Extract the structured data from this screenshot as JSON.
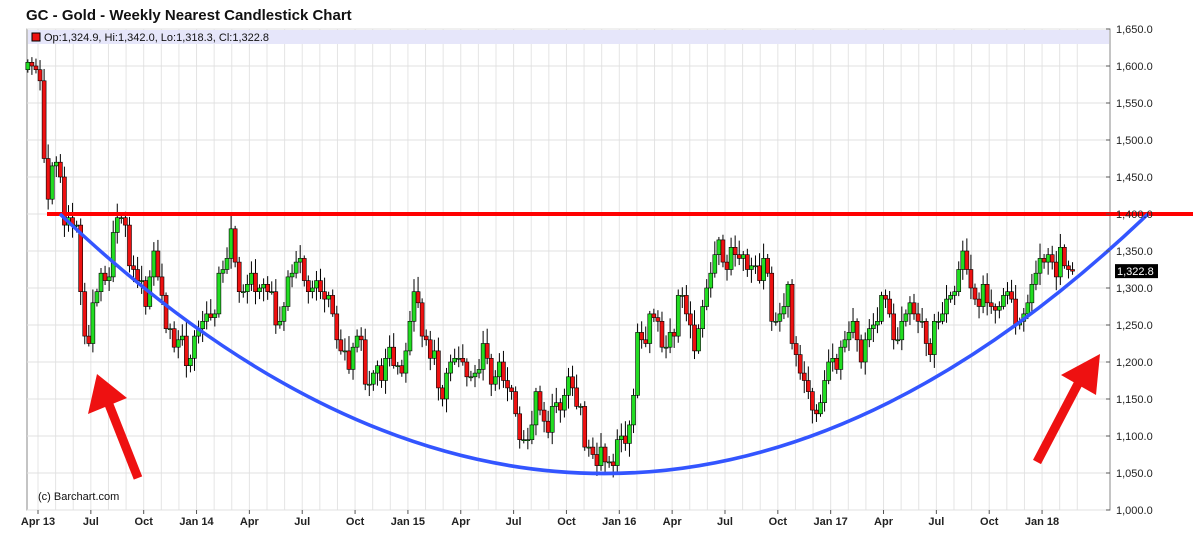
{
  "title": "GC - Gold - Weekly Nearest Candlestick Chart",
  "chart_data": {
    "type": "candlestick",
    "title": "GC - Gold - Weekly Nearest Candlestick Chart",
    "ohlc_label": "Op:1,324.9, Hi:1,342.0, Lo:1,318.3, Cl:1,322.8",
    "last_price_label": "1,322.8",
    "last_price": 1322.8,
    "ylim": [
      1000,
      1650
    ],
    "yticks": [
      "1,000.0",
      "1,050.0",
      "1,100.0",
      "1,150.0",
      "1,200.0",
      "1,250.0",
      "1,300.0",
      "1,350.0",
      "1,400.0",
      "1,450.0",
      "1,500.0",
      "1,550.0",
      "1,600.0",
      "1,650.0"
    ],
    "xticks": [
      "Apr 13",
      "Jul",
      "Oct",
      "Jan 14",
      "Apr",
      "Jul",
      "Oct",
      "Jan 15",
      "Apr",
      "Jul",
      "Oct",
      "Jan 16",
      "Apr",
      "Jul",
      "Oct",
      "Jan 17",
      "Apr",
      "Jul",
      "Oct",
      "Jan 18"
    ],
    "copyright": "(c) Barchart.com",
    "resistance_level": 1400,
    "first_open": 1595,
    "weekly_closes": [
      1605,
      1600,
      1595,
      1580,
      1475,
      1420,
      1465,
      1470,
      1450,
      1385,
      1395,
      1385,
      1385,
      1295,
      1235,
      1225,
      1280,
      1295,
      1320,
      1310,
      1315,
      1375,
      1395,
      1395,
      1385,
      1330,
      1325,
      1310,
      1310,
      1275,
      1315,
      1350,
      1315,
      1290,
      1245,
      1245,
      1220,
      1230,
      1235,
      1195,
      1205,
      1235,
      1245,
      1255,
      1265,
      1260,
      1265,
      1320,
      1325,
      1340,
      1380,
      1335,
      1295,
      1295,
      1305,
      1320,
      1295,
      1300,
      1305,
      1295,
      1295,
      1250,
      1255,
      1275,
      1315,
      1320,
      1335,
      1340,
      1310,
      1295,
      1300,
      1310,
      1295,
      1285,
      1290,
      1265,
      1230,
      1215,
      1215,
      1190,
      1220,
      1235,
      1230,
      1170,
      1170,
      1185,
      1195,
      1175,
      1205,
      1220,
      1195,
      1195,
      1185,
      1215,
      1255,
      1295,
      1280,
      1235,
      1230,
      1205,
      1215,
      1165,
      1150,
      1185,
      1200,
      1205,
      1205,
      1200,
      1180,
      1180,
      1185,
      1190,
      1225,
      1205,
      1170,
      1180,
      1200,
      1175,
      1165,
      1160,
      1130,
      1095,
      1095,
      1095,
      1115,
      1160,
      1135,
      1120,
      1105,
      1140,
      1145,
      1135,
      1155,
      1180,
      1165,
      1140,
      1140,
      1085,
      1085,
      1075,
      1060,
      1085,
      1065,
      1065,
      1060,
      1095,
      1100,
      1090,
      1115,
      1155,
      1240,
      1230,
      1225,
      1265,
      1260,
      1255,
      1220,
      1220,
      1240,
      1235,
      1290,
      1290,
      1265,
      1250,
      1215,
      1245,
      1275,
      1300,
      1320,
      1345,
      1365,
      1335,
      1325,
      1355,
      1345,
      1340,
      1345,
      1325,
      1330,
      1330,
      1310,
      1340,
      1320,
      1255,
      1255,
      1265,
      1275,
      1305,
      1225,
      1210,
      1185,
      1175,
      1160,
      1135,
      1130,
      1145,
      1175,
      1200,
      1205,
      1190,
      1220,
      1230,
      1240,
      1255,
      1230,
      1200,
      1230,
      1245,
      1250,
      1255,
      1290,
      1285,
      1265,
      1230,
      1230,
      1255,
      1265,
      1280,
      1265,
      1255,
      1255,
      1225,
      1210,
      1255,
      1255,
      1265,
      1285,
      1290,
      1295,
      1325,
      1350,
      1325,
      1300,
      1285,
      1275,
      1305,
      1280,
      1275,
      1270,
      1275,
      1290,
      1295,
      1285,
      1250,
      1255,
      1265,
      1280,
      1305,
      1320,
      1340,
      1335,
      1345,
      1335,
      1315,
      1355,
      1330,
      1324.9,
      1322.8
    ],
    "colors": {
      "up": "#22dd22",
      "down": "#ee1111",
      "resistance": "#ff0000",
      "curve": "#3355ff",
      "arrow": "#ee1111",
      "header": "#e6e6fa"
    }
  }
}
